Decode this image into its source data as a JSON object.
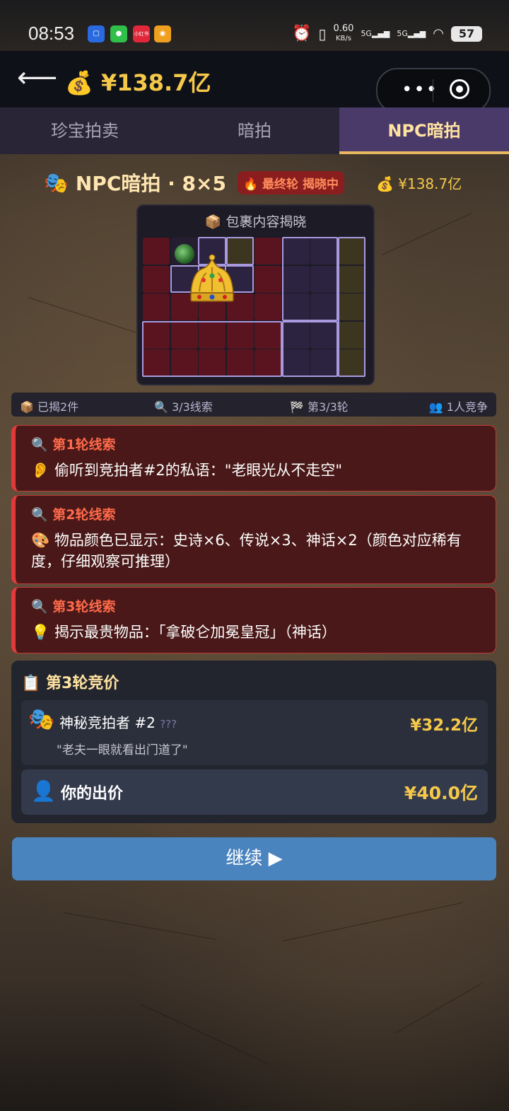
{
  "status_bar": {
    "time": "08:53",
    "apps": [
      "bank-app-icon",
      "wechat-icon",
      "xiaohongshu-icon",
      "weibo-icon"
    ],
    "xiaohongshu_label": "小红书",
    "net_speed": "0.60",
    "net_unit": "KB/s",
    "sim1": "5G",
    "sim2": "5G",
    "battery": "57"
  },
  "header": {
    "money_icon": "💰",
    "money": "¥138.7亿"
  },
  "tabs": [
    {
      "label": "珍宝拍卖",
      "active": false
    },
    {
      "label": "暗拍",
      "active": false
    },
    {
      "label": "NPC暗拍",
      "active": true
    }
  ],
  "title": {
    "icon": "🎭",
    "text": "NPC暗拍 · 8×5",
    "badge": "🔥 最终轮 揭晓中",
    "money": "💰 ¥138.7亿"
  },
  "package_panel": {
    "title": "📦 包裹内容揭晓"
  },
  "stats": {
    "revealed": "📦 已揭2件",
    "clues": "🔍 3/3线索",
    "round": "🏁 第3/3轮",
    "competitors": "👥 1人竞争"
  },
  "clues": [
    {
      "head": "🔍 第1轮线索",
      "body": "👂 偷听到竞拍者#2的私语：\"老眼光从不走空\""
    },
    {
      "head": "🔍 第2轮线索",
      "body": "🎨 物品颜色已显示：史诗×6、传说×3、神话×2（颜色对应稀有度，仔细观察可推理）"
    },
    {
      "head": "🔍 第3轮线索",
      "body": "💡 揭示最贵物品：「拿破仑加冕皇冠」（神话）"
    }
  ],
  "bidding": {
    "title": "📋 第3轮竞价",
    "npc": {
      "icon": "🎭",
      "name": "神秘竞拍者 #2",
      "tag": "???",
      "quote": "\"老夫一眼就看出门道了\"",
      "price": "¥32.2亿"
    },
    "you": {
      "icon": "👤",
      "label": "你的出价",
      "price": "¥40.0亿"
    }
  },
  "continue_button": "继续 ▶"
}
